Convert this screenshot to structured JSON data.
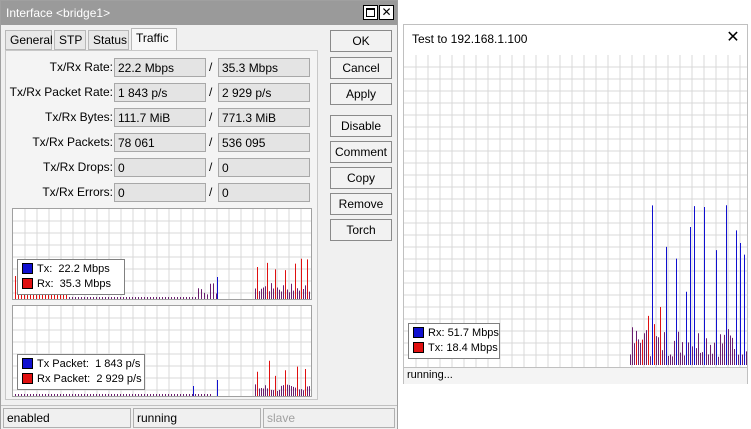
{
  "interface_window": {
    "title": "Interface <bridge1>",
    "tabs": [
      {
        "label": "General"
      },
      {
        "label": "STP"
      },
      {
        "label": "Status"
      },
      {
        "label": "Traffic",
        "active": true
      }
    ],
    "fields": [
      {
        "label": "Tx/Rx Rate:",
        "tx": "22.2 Mbps",
        "rx": "35.3 Mbps"
      },
      {
        "label": "Tx/Rx Packet Rate:",
        "tx": "1 843 p/s",
        "rx": "2 929 p/s"
      },
      {
        "label": "Tx/Rx Bytes:",
        "tx": "111.7 MiB",
        "rx": "771.3 MiB"
      },
      {
        "label": "Tx/Rx Packets:",
        "tx": "78 061",
        "rx": "536 095"
      },
      {
        "label": "Tx/Rx Drops:",
        "tx": "0",
        "rx": "0"
      },
      {
        "label": "Tx/Rx Errors:",
        "tx": "0",
        "rx": "0"
      }
    ],
    "separator": "/",
    "rate_graph_legend": [
      {
        "label": "Tx:",
        "value": "22.2 Mbps",
        "color": "#1010d0"
      },
      {
        "label": "Rx:",
        "value": "35.3 Mbps",
        "color": "#e01010"
      }
    ],
    "packet_graph_legend": [
      {
        "label": "Tx Packet:",
        "value": "1 843 p/s",
        "color": "#1010d0"
      },
      {
        "label": "Rx Packet:",
        "value": "2 929 p/s",
        "color": "#e01010"
      }
    ],
    "buttons": {
      "ok": "OK",
      "cancel": "Cancel",
      "apply": "Apply",
      "disable": "Disable",
      "comment": "Comment",
      "copy": "Copy",
      "remove": "Remove",
      "torch": "Torch"
    },
    "status_bar": {
      "enabled": "enabled",
      "running": "running",
      "slave": "slave"
    }
  },
  "test_window": {
    "title": "Test to 192.168.1.100",
    "close_icon": "close-icon",
    "legend": [
      {
        "label": "Rx:",
        "value": "51.7 Mbps",
        "color": "#1010d0"
      },
      {
        "label": "Tx:",
        "value": "18.4 Mbps",
        "color": "#e01010"
      }
    ],
    "status": "running..."
  },
  "colors": {
    "tx_blue": "#1010d0",
    "rx_red": "#e01010",
    "overlap_purple": "#6a1e6e",
    "title_bar": "#9a9a9a",
    "grid": "#d8d8d8"
  }
}
